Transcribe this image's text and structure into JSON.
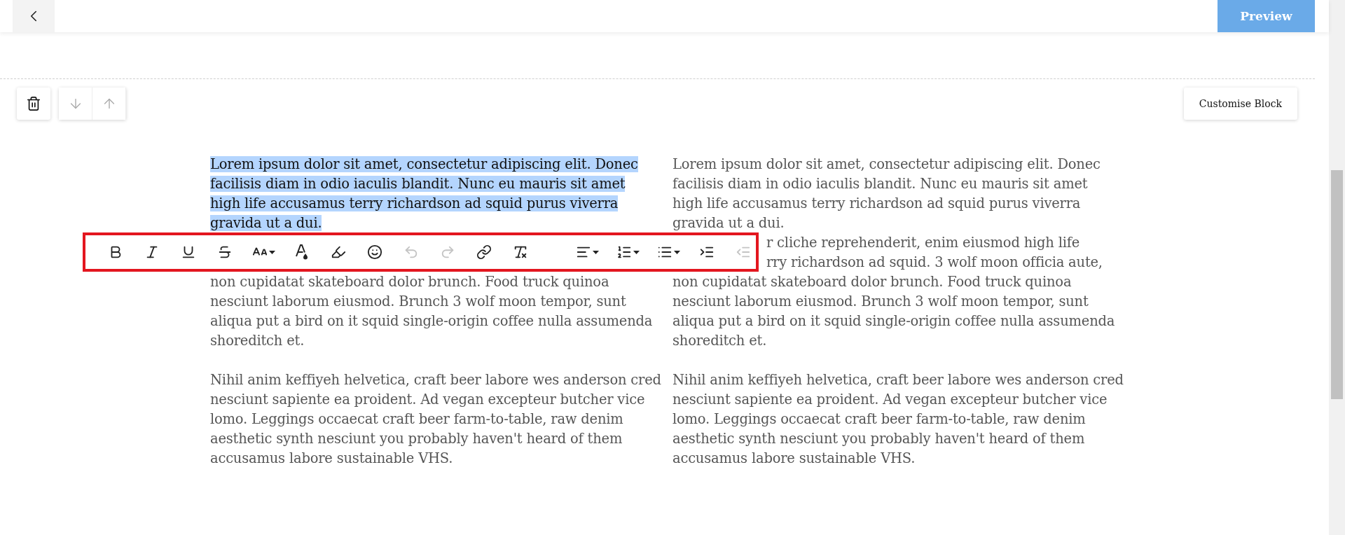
{
  "header": {
    "back_button": {
      "kind": "back"
    },
    "preview_button": {
      "label": "Preview"
    }
  },
  "block_toolbar": {
    "actions": [
      {
        "kind": "delete",
        "disabled": false
      },
      {
        "kind": "move_down",
        "disabled": true
      },
      {
        "kind": "move_up",
        "disabled": true
      }
    ],
    "customise_button": {
      "label": "Customise Block"
    }
  },
  "format_toolbar": {
    "tools": [
      {
        "kind": "bold",
        "disabled": false,
        "dropdown": false
      },
      {
        "kind": "italic",
        "disabled": false,
        "dropdown": false
      },
      {
        "kind": "underline",
        "disabled": false,
        "dropdown": false
      },
      {
        "kind": "strikethrough",
        "disabled": false,
        "dropdown": false
      },
      {
        "kind": "font_size",
        "disabled": false,
        "dropdown": true
      },
      {
        "kind": "text_color",
        "disabled": false,
        "dropdown": false
      },
      {
        "kind": "highlight",
        "disabled": false,
        "dropdown": false
      },
      {
        "kind": "emoji",
        "disabled": false,
        "dropdown": false
      },
      {
        "kind": "undo",
        "disabled": true,
        "dropdown": false
      },
      {
        "kind": "redo",
        "disabled": true,
        "dropdown": false
      },
      {
        "kind": "link",
        "disabled": false,
        "dropdown": false
      },
      {
        "kind": "clear_format",
        "disabled": false,
        "dropdown": false
      },
      {
        "kind": "align",
        "disabled": false,
        "dropdown": true
      },
      {
        "kind": "ordered_list",
        "disabled": false,
        "dropdown": true
      },
      {
        "kind": "bullet_list",
        "disabled": false,
        "dropdown": true
      },
      {
        "kind": "indent",
        "disabled": false,
        "dropdown": false
      },
      {
        "kind": "outdent",
        "disabled": true,
        "dropdown": false
      }
    ]
  },
  "columns": [
    {
      "paragraphs": [
        {
          "selected": true,
          "lines": [
            "Lorem ipsum dolor sit amet, consectetur adipiscing elit. Donec",
            "facilisis diam in odio iaculis blandit. Nunc eu mauris sit amet",
            "high life accusamus terry richardson ad squid purus viverra",
            "gravida ut a dui."
          ]
        },
        {
          "selected": false,
          "lines": [
            "non cupidatat skateboard dolor brunch. Food truck quinoa",
            "nesciunt laborum eiusmod. Brunch 3 wolf moon tempor, sunt",
            "aliqua put a bird on it squid single-origin coffee nulla assumenda",
            "shoreditch et."
          ]
        },
        {
          "selected": false,
          "lines": [
            "Nihil anim keffiyeh helvetica, craft beer labore wes anderson cred",
            "nesciunt sapiente ea proident. Ad vegan excepteur butcher vice",
            "lomo. Leggings occaecat craft beer farm-to-table, raw denim",
            "aesthetic synth nesciunt you probably haven't heard of them",
            "accusamus labore sustainable VHS."
          ]
        }
      ]
    },
    {
      "paragraphs": [
        {
          "selected": false,
          "lines": [
            "Lorem ipsum dolor sit amet, consectetur adipiscing elit. Donec",
            "facilisis diam in odio iaculis blandit. Nunc eu mauris sit amet",
            "high life accusamus terry richardson ad squid purus viverra",
            "gravida ut a dui."
          ]
        },
        {
          "selected": false,
          "covered_lines": [
            "r cliche reprehenderit, enim eiusmod high life",
            "rry richardson ad squid. 3 wolf moon officia aute,"
          ],
          "lines": [
            "non cupidatat skateboard dolor brunch. Food truck quinoa",
            "nesciunt laborum eiusmod. Brunch 3 wolf moon tempor, sunt",
            "aliqua put a bird on it squid single-origin coffee nulla assumenda",
            "shoreditch et."
          ]
        },
        {
          "selected": false,
          "lines": [
            "Nihil anim keffiyeh helvetica, craft beer labore wes anderson cred",
            "nesciunt sapiente ea proident. Ad vegan excepteur butcher vice",
            "lomo. Leggings occaecat craft beer farm-to-table, raw denim",
            "aesthetic synth nesciunt you probably haven't heard of them",
            "accusamus labore sustainable VHS."
          ]
        }
      ]
    }
  ]
}
